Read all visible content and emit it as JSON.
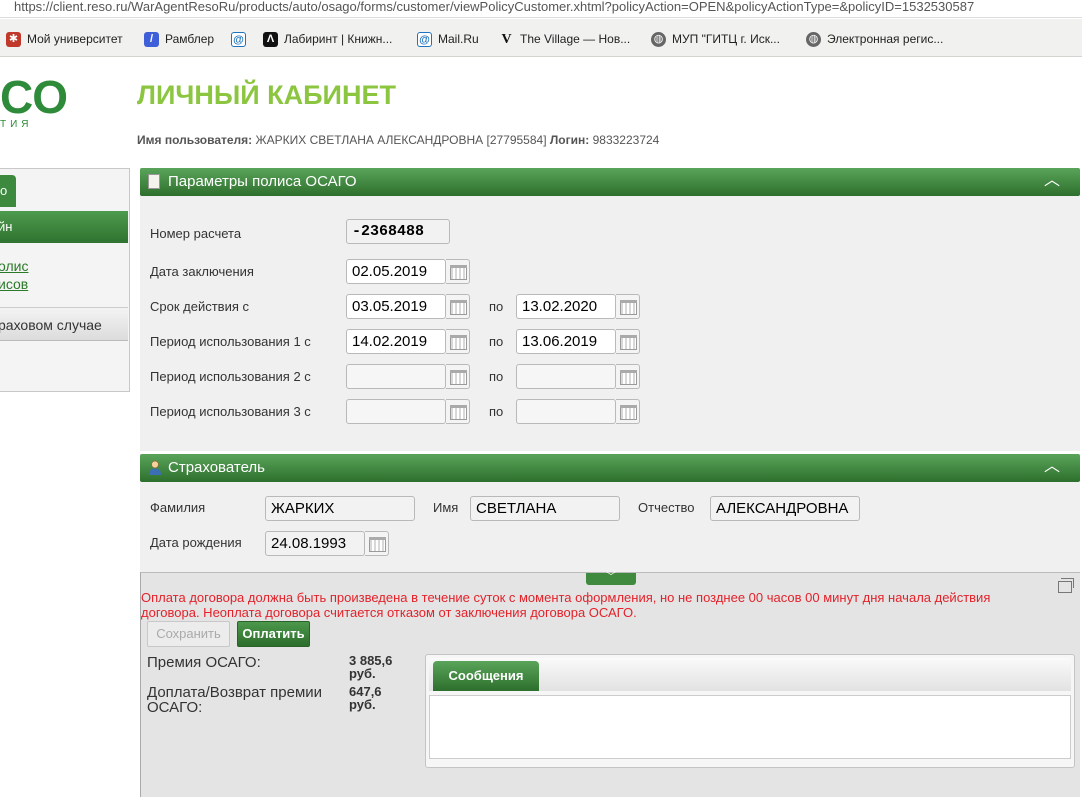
{
  "browser": {
    "url": "https://client.reso.ru/WarAgentResoRu/products/auto/osago/forms/customer/viewPolicyCustomer.xhtml?policyAction=OPEN&policyActionType=&policyID=1532530587",
    "bookmarks": [
      {
        "label": "Мой университет",
        "icon": "university-icon",
        "color": "#c0392b"
      },
      {
        "label": "Рамблер",
        "icon": "rambler-icon",
        "color": "#3f5fd8"
      },
      {
        "label": "",
        "icon": "at-icon",
        "color": "#1e73be"
      },
      {
        "label": "Лабиринт | Книжн...",
        "icon": "labirint-icon",
        "color": "#111111"
      },
      {
        "label": "Mail.Ru",
        "icon": "mailru-icon",
        "color": "#1e73be"
      },
      {
        "label": "The Village — Нов...",
        "icon": "village-icon",
        "color": "#111111"
      },
      {
        "label": "МУП \"ГИТЦ г. Иск...",
        "icon": "globe-icon",
        "color": "#555555"
      },
      {
        "label": "Электронная регис...",
        "icon": "globe-icon",
        "color": "#555555"
      }
    ]
  },
  "logo": {
    "text": "CO",
    "sub": "ТИЯ"
  },
  "header": {
    "title": "ЛИЧНЫЙ КАБИНЕТ",
    "user_label": "Имя пользователя:",
    "user_value": "ЖАРКИХ СВЕТЛАНА АЛЕКСАНДРОВНА [27795584]",
    "login_label": "Логин:",
    "login_value": "9833223724"
  },
  "sidebar": {
    "tab": "о",
    "active": "йн",
    "link1": "олис",
    "link2": "исов",
    "button": "раховом случае"
  },
  "policy_panel": {
    "title": "Параметры полиса ОСАГО",
    "calc_label": "Номер расчета",
    "calc_value": "-2368488",
    "date_label": "Дата заключения",
    "date_value": "02.05.2019",
    "term_label": "Срок действия с",
    "term_from": "03.05.2019",
    "term_to": "13.02.2020",
    "to_label": "по",
    "period1_label": "Период использования 1 с",
    "period1_from": "14.02.2019",
    "period1_to": "13.06.2019",
    "period2_label": "Период использования 2 с",
    "period3_label": "Период использования 3 с"
  },
  "insurer_panel": {
    "title": "Страхователь",
    "surname_label": "Фамилия",
    "surname_value": "ЖАРКИХ",
    "name_label": "Имя",
    "name_value": "СВЕТЛАНА",
    "patronymic_label": "Отчество",
    "patronymic_value": "АЛЕКСАНДРОВНА",
    "birth_label": "Дата рождения",
    "birth_value": "24.08.1993"
  },
  "bottom": {
    "warning": "Оплата договора должна быть произведена в течение суток с момента оформления, но не позднее 00 часов 00 минут дня начала действия договора. Неоплата договора считается отказом от заключения договора ОСАГО.",
    "save_label": "Сохранить",
    "pay_label": "Оплатить",
    "premium_label": "Премия ОСАГО:",
    "premium_value": "3 885,6",
    "premium_unit": "руб.",
    "surcharge_label_1": "Доплата/Возврат премии",
    "surcharge_label_2": "ОСАГО:",
    "surcharge_value": "647,6",
    "surcharge_unit": "руб.",
    "messages_tab": "Сообщения"
  }
}
